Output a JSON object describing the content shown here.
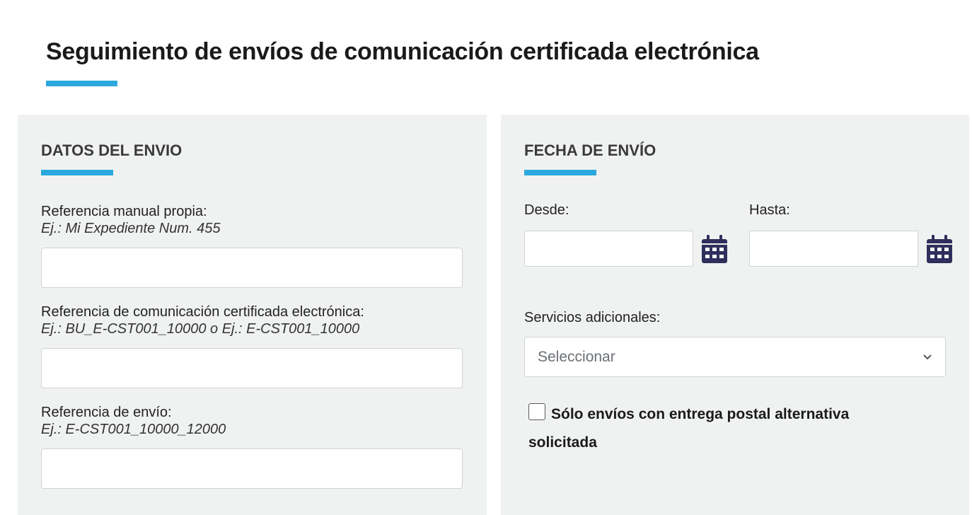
{
  "page": {
    "title": "Seguimiento de envíos de comunicación certificada electrónica"
  },
  "left_panel": {
    "section_title": "DATOS DEL ENVIO",
    "fields": [
      {
        "label": "Referencia manual propia:",
        "hint": "Ej.: Mi Expediente Num. 455",
        "value": ""
      },
      {
        "label": "Referencia de comunicación certificada electrónica:",
        "hint": "Ej.: BU_E-CST001_10000 o Ej.: E-CST001_10000",
        "value": ""
      },
      {
        "label": "Referencia de envío:",
        "hint": "Ej.: E-CST001_10000_12000",
        "value": ""
      }
    ]
  },
  "right_panel": {
    "section_title": "FECHA DE ENVÍO",
    "date_from": {
      "label": "Desde:",
      "value": "",
      "icon": "calendar-icon"
    },
    "date_to": {
      "label": "Hasta:",
      "value": "",
      "icon": "calendar-icon"
    },
    "services": {
      "label": "Servicios adicionales:",
      "selected": "Seleccionar"
    },
    "postal_checkbox": {
      "label": "Sólo envíos con entrega postal alternativa solicitada",
      "checked": false
    }
  },
  "colors": {
    "accent": "#2ba8dc",
    "panel_bg": "#f0f2f1",
    "icon": "#2e2f5c"
  }
}
